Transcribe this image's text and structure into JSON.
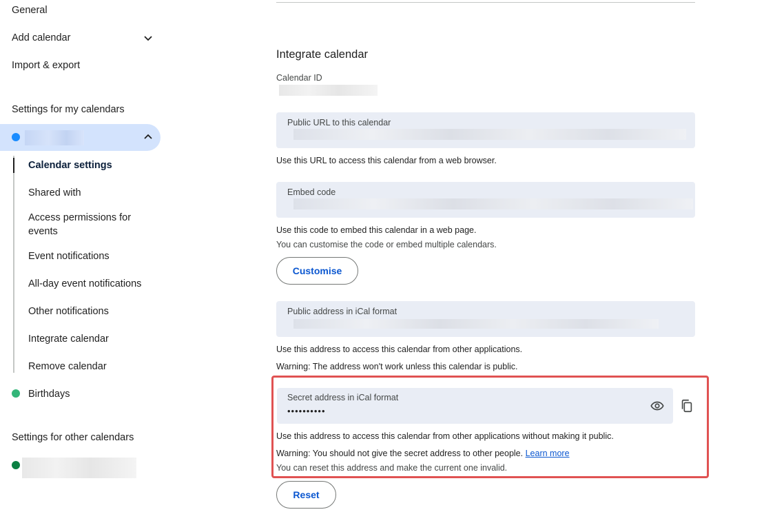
{
  "sidebar": {
    "items": [
      {
        "label": "General"
      },
      {
        "label": "Add calendar"
      },
      {
        "label": "Import & export"
      }
    ],
    "my_calendars_title": "Settings for my calendars",
    "sub_items": [
      {
        "label": "Calendar settings"
      },
      {
        "label": "Shared with"
      },
      {
        "label": "Access permissions for events"
      },
      {
        "label": "Event notifications"
      },
      {
        "label": "All-day event notifications"
      },
      {
        "label": "Other notifications"
      },
      {
        "label": "Integrate calendar"
      },
      {
        "label": "Remove calendar"
      }
    ],
    "birthdays_label": "Birthdays",
    "other_calendars_title": "Settings for other calendars",
    "colors": {
      "selected_dot": "#1a8cff",
      "birthdays_dot": "#33b679",
      "other_dot": "#0b8043",
      "selected_bg": "#d3e3fd"
    }
  },
  "main": {
    "section_title": "Integrate calendar",
    "calendar_id_label": "Calendar ID",
    "public_url": {
      "label": "Public URL to this calendar",
      "help": "Use this URL to access this calendar from a web browser."
    },
    "embed": {
      "label": "Embed code",
      "help1": "Use this code to embed this calendar in a web page.",
      "help2": "You can customise the code or embed multiple calendars.",
      "button": "Customise"
    },
    "public_ical": {
      "label": "Public address in iCal format",
      "help1": "Use this address to access this calendar from other applications.",
      "help2": "Warning: The address won't work unless this calendar is public."
    },
    "secret_ical": {
      "label": "Secret address in iCal format",
      "value": "••••••••••",
      "help1": "Use this address to access this calendar from other applications without making it public.",
      "help2": "Warning: You should not give the secret address to other people.",
      "learn_more": "Learn more",
      "help3": "You can reset this address and make the current one invalid.",
      "reset_button": "Reset"
    },
    "colors": {
      "accent": "#0b57d0",
      "field_bg": "#e9edf5",
      "highlight": "#e05252"
    }
  }
}
